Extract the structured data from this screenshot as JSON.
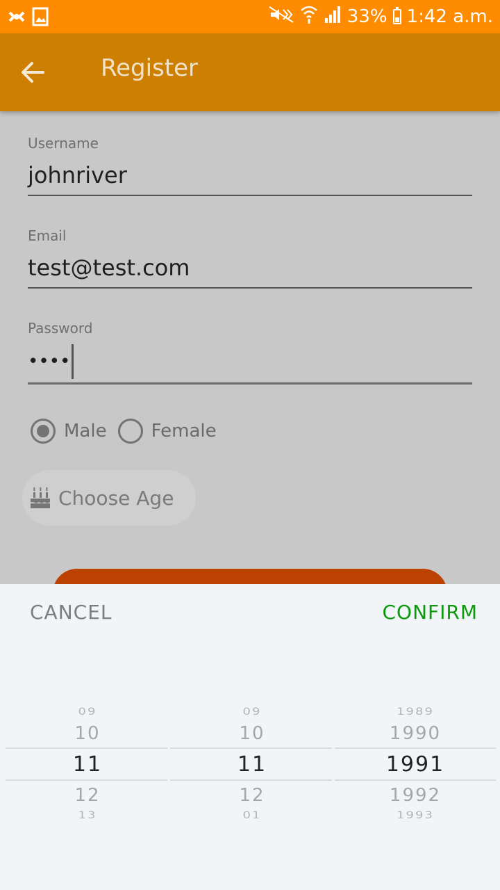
{
  "status_bar": {
    "battery_text": "33%",
    "time": "1:42 a.m."
  },
  "app_bar": {
    "title": "Register"
  },
  "form": {
    "username": {
      "label": "Username",
      "value": "johnriver"
    },
    "email": {
      "label": "Email",
      "value": "test@test.com"
    },
    "password": {
      "label": "Password",
      "value": "••••"
    },
    "gender": {
      "options": [
        {
          "label": "Male",
          "checked": true
        },
        {
          "label": "Female",
          "checked": false
        }
      ]
    },
    "age_button": {
      "label": "Choose Age"
    }
  },
  "picker": {
    "cancel_label": "CANCEL",
    "confirm_label": "CONFIRM",
    "columns": [
      {
        "items": [
          "09",
          "10",
          "11",
          "12",
          "13"
        ],
        "selected": "11"
      },
      {
        "items": [
          "09",
          "10",
          "11",
          "12",
          "01"
        ],
        "selected": "11"
      },
      {
        "items": [
          "1989",
          "1990",
          "1991",
          "1992",
          "1993"
        ],
        "selected": "1991"
      }
    ]
  },
  "colors": {
    "status_bar": "#ff8c00",
    "app_bar": "#cc7f00",
    "register_button": "#bb4200",
    "confirm": "#0a9a0a"
  }
}
